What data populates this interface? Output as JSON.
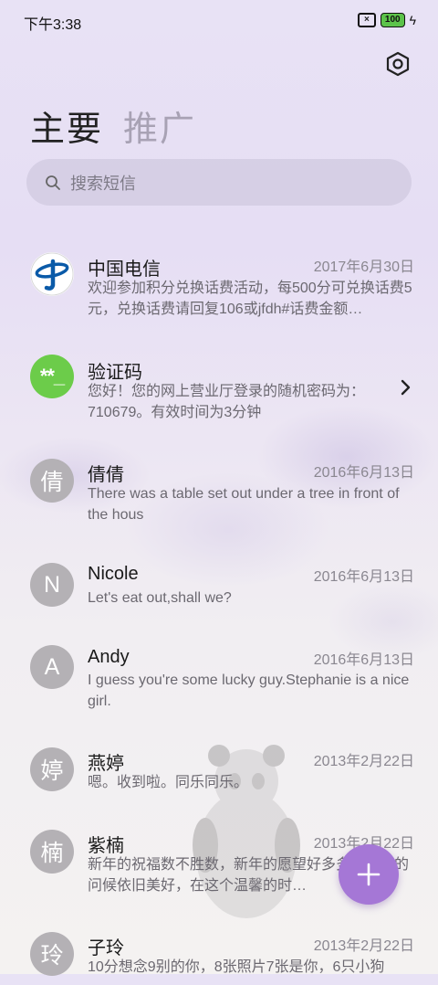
{
  "status_bar": {
    "time": "下午3:38",
    "battery": "100"
  },
  "header": {
    "tabs": [
      {
        "label": "主要",
        "active": true
      },
      {
        "label": "推广",
        "active": false
      }
    ]
  },
  "search": {
    "placeholder": "搜索短信"
  },
  "conversations": [
    {
      "name": "中国电信",
      "date": "2017年6月30日",
      "preview": "欢迎参加积分兑换话费活动，每500分可兑换话费5元，兑换话费请回复106或jfdh#话费金额…",
      "avatar": "telecom-logo"
    },
    {
      "name": "验证码",
      "date": "",
      "preview": "您好！您的网上营业厅登录的随机密码为：710679。有效时间为3分钟",
      "avatar_text": "**_"
    },
    {
      "name": "倩倩",
      "date": "2016年6月13日",
      "preview": "There was a table set out under a tree in front of the hous",
      "avatar_text": "倩"
    },
    {
      "name": "Nicole",
      "date": "2016年6月13日",
      "preview": "Let's eat out,shall we?",
      "avatar_text": "N"
    },
    {
      "name": "Andy",
      "date": "2016年6月13日",
      "preview": "I guess you're some lucky guy.Stephanie is a nice girl.",
      "avatar_text": "A"
    },
    {
      "name": "燕婷",
      "date": "2013年2月22日",
      "preview": "嗯。收到啦。同乐同乐。",
      "avatar_text": "婷"
    },
    {
      "name": "紫楠",
      "date": "2013年2月22日",
      "preview": "新年的祝福数不胜数，新年的愿望好多多，新年的问候依旧美好，在这个温馨的时…",
      "avatar_text": "楠"
    },
    {
      "name": "子玲",
      "date": "2013年2月22日",
      "preview": "10分想念9别的你，8张照片7张是你，6只小狗",
      "avatar_text": "玲"
    }
  ],
  "colors": {
    "accent": "#a577d6",
    "verify_green": "#6ccc4a",
    "telecom_blue": "#0a5aa8"
  }
}
